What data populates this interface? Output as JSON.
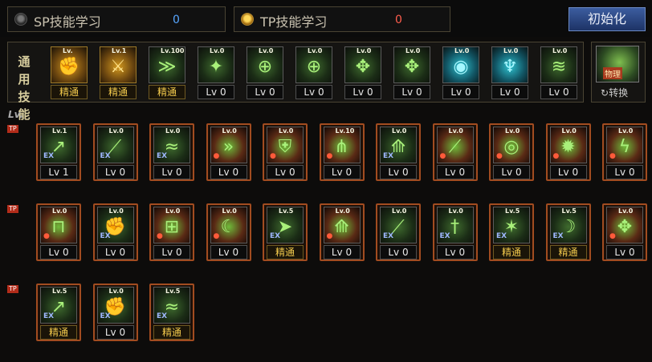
{
  "points": {
    "sp": {
      "label": "SP技能学习",
      "value": "0"
    },
    "tp": {
      "label": "TP技能学习",
      "value": "0"
    }
  },
  "reset_button": "初始化",
  "common": {
    "label_line1": "通用",
    "label_line2": "技能",
    "skills": [
      {
        "icon": "scroll-fist-icon",
        "tag": "Lv.",
        "level": "精通",
        "style": "gold"
      },
      {
        "icon": "gold-fighter-icon",
        "tag": "Lv.1",
        "level": "精通",
        "style": "gold"
      },
      {
        "icon": "dash-strike-icon",
        "tag": "Lv.100",
        "level": "精通",
        "style": "green"
      },
      {
        "icon": "wings-icon",
        "tag": "Lv.0",
        "level": "Lv 0",
        "style": "green"
      },
      {
        "icon": "crosshair-icon",
        "tag": "Lv.0",
        "level": "Lv 0",
        "style": "green"
      },
      {
        "icon": "crosshair-icon",
        "tag": "Lv.0",
        "level": "Lv 0",
        "style": "green"
      },
      {
        "icon": "beast-icon",
        "tag": "Lv.0",
        "level": "Lv 0",
        "style": "green"
      },
      {
        "icon": "beast-icon",
        "tag": "Lv.0",
        "level": "Lv 0",
        "style": "green"
      },
      {
        "icon": "eye-icon",
        "tag": "Lv.0",
        "level": "Lv 0",
        "style": "cyan"
      },
      {
        "icon": "human-figure-icon",
        "tag": "Lv.0",
        "level": "Lv 0",
        "style": "cyan"
      },
      {
        "icon": "scroll-icon",
        "tag": "Lv.0",
        "level": "Lv 0",
        "style": "green"
      }
    ]
  },
  "switch": {
    "icon_label": "物理",
    "label": "转换"
  },
  "lv_mark": "Lv.",
  "row_tag": "TP",
  "tp_rows": [
    [
      {
        "icon": "kick-icon",
        "tag": "Lv.1",
        "level": "Lv 1",
        "corner": "EX"
      },
      {
        "icon": "slash-icon",
        "tag": "Lv.0",
        "level": "Lv 0",
        "corner": "EX"
      },
      {
        "icon": "wave-icon",
        "tag": "Lv.0",
        "level": "Lv 0",
        "corner": "EX"
      },
      {
        "icon": "triple-arrow-icon",
        "tag": "Lv.0",
        "level": "Lv 0",
        "corner": "red"
      },
      {
        "icon": "shield-icon",
        "tag": "Lv.0",
        "level": "Lv 0",
        "corner": "red"
      },
      {
        "icon": "spikes-icon",
        "tag": "Lv.10",
        "level": "Lv 0",
        "corner": "red"
      },
      {
        "icon": "claw-icon",
        "tag": "Lv.0",
        "level": "Lv 0",
        "corner": "EX"
      },
      {
        "icon": "slash-icon",
        "tag": "Lv.0",
        "level": "Lv 0",
        "corner": "red"
      },
      {
        "icon": "vortex-icon",
        "tag": "Lv.0",
        "level": "Lv 0",
        "corner": "red"
      },
      {
        "icon": "burst-icon",
        "tag": "Lv.0",
        "level": "Lv 0",
        "corner": "red"
      },
      {
        "icon": "lightning-icon",
        "tag": "Lv.0",
        "level": "Lv 0",
        "corner": "red"
      }
    ],
    [
      {
        "icon": "gate-icon",
        "tag": "Lv.0",
        "level": "Lv 0",
        "corner": "red"
      },
      {
        "icon": "fist-icon",
        "tag": "Lv.0",
        "level": "Lv 0",
        "corner": "EX"
      },
      {
        "icon": "pillar-icon",
        "tag": "Lv.0",
        "level": "Lv 0",
        "corner": "red"
      },
      {
        "icon": "crescent-icon",
        "tag": "Lv.0",
        "level": "Lv 0",
        "corner": "red"
      },
      {
        "icon": "dash-icon",
        "tag": "Lv.5",
        "level": "精通",
        "corner": "EX"
      },
      {
        "icon": "claw-icon",
        "tag": "Lv.0",
        "level": "Lv 0",
        "corner": "red"
      },
      {
        "icon": "slash-icon",
        "tag": "Lv.0",
        "level": "Lv 0",
        "corner": "EX"
      },
      {
        "icon": "sword-icon",
        "tag": "Lv.0",
        "level": "Lv 0",
        "corner": "EX"
      },
      {
        "icon": "star-burst-icon",
        "tag": "Lv.5",
        "level": "精通",
        "corner": "EX"
      },
      {
        "icon": "moon-icon",
        "tag": "Lv.5",
        "level": "精通",
        "corner": "EX"
      },
      {
        "icon": "beast-icon",
        "tag": "Lv.0",
        "level": "Lv 0",
        "corner": "red"
      }
    ],
    [
      {
        "icon": "kick-icon",
        "tag": "Lv.5",
        "level": "精通",
        "corner": "EX"
      },
      {
        "icon": "fist-icon",
        "tag": "Lv.0",
        "level": "Lv 0",
        "corner": "EX"
      },
      {
        "icon": "wave-icon",
        "tag": "Lv.5",
        "level": "精通",
        "corner": "EX"
      }
    ]
  ]
}
